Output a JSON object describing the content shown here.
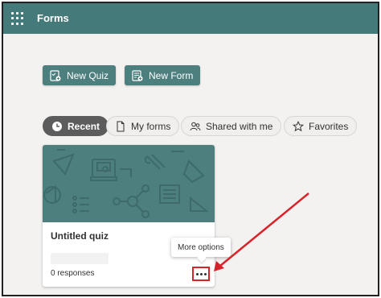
{
  "header": {
    "title": "Forms"
  },
  "toolbar": {
    "new_quiz_label": "New Quiz",
    "new_form_label": "New Form"
  },
  "filters": {
    "recent": "Recent",
    "my_forms": "My forms",
    "shared": "Shared with me",
    "favorites": "Favorites"
  },
  "card": {
    "title": "Untitled quiz",
    "responses": "0 responses",
    "more_icon": "ellipsis-icon"
  },
  "tooltip": {
    "text": "More options"
  },
  "colors": {
    "brand": "#457a7a",
    "button": "#4d7f7e",
    "highlight": "#d8232a"
  }
}
